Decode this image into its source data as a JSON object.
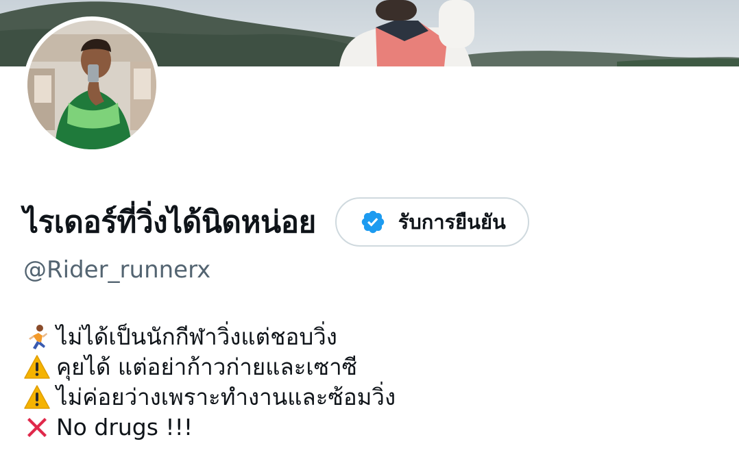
{
  "profile": {
    "display_name": "ไรเดอร์ที่วิ่งได้นิดหน่อย",
    "handle": "@Rider_runnerx",
    "verify_button_label": "รับการยืนยัน",
    "verify_icon": "verified-badge-icon"
  },
  "bio": {
    "lines": [
      {
        "icon": "runner-emoji",
        "text": "ไม่ได้เป็นนักกีฬาวิ่งแต่ชอบวิ่ง"
      },
      {
        "icon": "warning-emoji",
        "text": "คุยได้ แต่อย่าก้าวก่ายและเซาซี"
      },
      {
        "icon": "warning-emoji",
        "text": "ไม่ค่อยว่างเพราะทำงานและซ้อมวิ่ง"
      },
      {
        "icon": "cross-mark-emoji",
        "text": "No drugs !!!"
      }
    ]
  },
  "colors": {
    "verified_blue": "#1d9bf0",
    "text_primary": "#0f1419",
    "text_secondary": "#536471",
    "border": "#cfd9de"
  }
}
